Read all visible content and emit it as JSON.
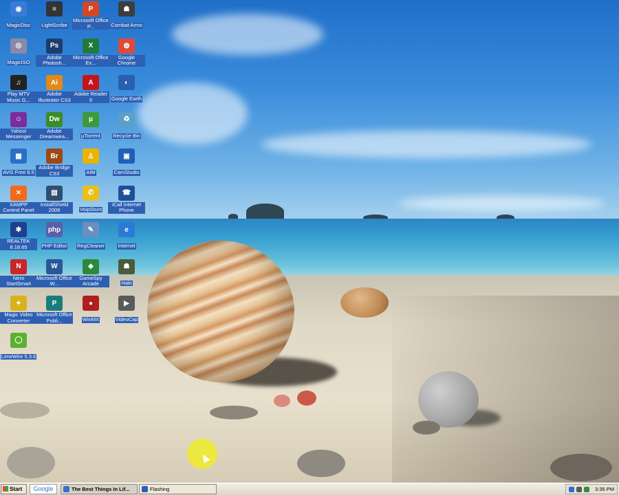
{
  "desktop_icons": [
    {
      "label": "MagicDisc",
      "icon": "disc-icon",
      "color": "#3a7bd5",
      "glyph": "◉"
    },
    {
      "label": "LightScribe",
      "icon": "lightscribe-icon",
      "color": "#333333",
      "glyph": "≡"
    },
    {
      "label": "Microsoft Office P...",
      "icon": "powerpoint-icon",
      "color": "#d24726",
      "glyph": "P"
    },
    {
      "label": "Combat Arms",
      "icon": "soldier-icon",
      "color": "#3d3d3d",
      "glyph": "☗"
    },
    {
      "label": "MagicISO",
      "icon": "cd-icon",
      "color": "#8a8aa8",
      "glyph": "◎"
    },
    {
      "label": "Adobe Photosh...",
      "icon": "photoshop-icon",
      "color": "#1d3c6e",
      "glyph": "Ps"
    },
    {
      "label": "Microsoft Office Ex...",
      "icon": "excel-icon",
      "color": "#1f7a3c",
      "glyph": "X"
    },
    {
      "label": "Google Chrome",
      "icon": "chrome-icon",
      "color": "#dd4b39",
      "glyph": "◍"
    },
    {
      "label": "Play MTV Music G...",
      "icon": "mtv-icon",
      "color": "#222222",
      "glyph": "♫"
    },
    {
      "label": "Adobe Illustrator CS3",
      "icon": "illustrator-icon",
      "color": "#e08a18",
      "glyph": "Ai"
    },
    {
      "label": "Adobe Reader 9",
      "icon": "pdf-icon",
      "color": "#c4151c",
      "glyph": "A"
    },
    {
      "label": "Google Earth",
      "icon": "globe-icon",
      "color": "#2a5fb0",
      "glyph": "◐"
    },
    {
      "label": "Yahoo! Messenger",
      "icon": "smiley-icon",
      "color": "#7b2d9c",
      "glyph": "☺"
    },
    {
      "label": "Adobe Dreamwea...",
      "icon": "dreamweaver-icon",
      "color": "#3b8c2a",
      "glyph": "Dw"
    },
    {
      "label": "µTorrent",
      "icon": "utorrent-icon",
      "color": "#3b9b3b",
      "glyph": "µ"
    },
    {
      "label": "Recycle Bin",
      "icon": "recycle-bin-icon",
      "color": "#5aa0c8",
      "glyph": "♻"
    },
    {
      "label": "AVG Free 8.5",
      "icon": "avg-icon",
      "color": "#2c6fc7",
      "glyph": "▦"
    },
    {
      "label": "Adobe Bridge CS3",
      "icon": "bridge-icon",
      "color": "#9b4a16",
      "glyph": "Br"
    },
    {
      "label": "AIM",
      "icon": "aim-icon",
      "color": "#e8b400",
      "glyph": "♙"
    },
    {
      "label": "CamStudio",
      "icon": "camstudio-icon",
      "color": "#1f5fb8",
      "glyph": "▣"
    },
    {
      "label": "XAMPP Control Panel",
      "icon": "xampp-icon",
      "color": "#f26a1b",
      "glyph": "⨯"
    },
    {
      "label": "InstallShield 2009",
      "icon": "installshield-icon",
      "color": "#2f4f6f",
      "glyph": "▤"
    },
    {
      "label": "VoipStunt",
      "icon": "voipstunt-icon",
      "color": "#e8c01a",
      "glyph": "✆"
    },
    {
      "label": "iCall Internet Phone",
      "icon": "phone-icon",
      "color": "#1c4f9c",
      "glyph": "☎"
    },
    {
      "label": "REALTEK 8.18.65",
      "icon": "realtek-icon",
      "color": "#1e3f8f",
      "glyph": "✱"
    },
    {
      "label": "PHP Editor",
      "icon": "php-icon",
      "color": "#5a5fa8",
      "glyph": "php"
    },
    {
      "label": "RegCleaner",
      "icon": "regcleaner-icon",
      "color": "#6b8fc0",
      "glyph": "✎"
    },
    {
      "label": "Internet",
      "icon": "internet-explorer-icon",
      "color": "#2a7bd6",
      "glyph": "e"
    },
    {
      "label": "Nero StartSmart",
      "icon": "nero-icon",
      "color": "#c9262b",
      "glyph": "N"
    },
    {
      "label": "Microsoft Office W...",
      "icon": "word-icon",
      "color": "#2b579a",
      "glyph": "W"
    },
    {
      "label": "GameSpy Arcade",
      "icon": "gamespy-icon",
      "color": "#2a8a3a",
      "glyph": "◈"
    },
    {
      "label": "Halo",
      "icon": "halo-icon",
      "color": "#4a5a3a",
      "glyph": "☗"
    },
    {
      "label": "Magic Video Converter",
      "icon": "video-converter-icon",
      "color": "#d9b21b",
      "glyph": "✦"
    },
    {
      "label": "Microsoft Office Publi...",
      "icon": "publisher-icon",
      "color": "#1a7d7d",
      "glyph": "P"
    },
    {
      "label": "WinMX",
      "icon": "winmx-icon",
      "color": "#b01e1e",
      "glyph": "●"
    },
    {
      "label": "VideoCap",
      "icon": "videocap-icon",
      "color": "#5a5a5a",
      "glyph": "▶"
    },
    {
      "label": "LimeWire 5.3.6",
      "icon": "limewire-icon",
      "color": "#5bb030",
      "glyph": "◯"
    }
  ],
  "taskbar": {
    "start_label": "Start",
    "google_label": "Google",
    "tasks": [
      {
        "label": "The Best Things In Lif...",
        "icon": "browser-window-icon",
        "color": "#3a6fc8",
        "active": true
      },
      {
        "label": "Flashing",
        "icon": "app-window-icon",
        "color": "#2d5fb3",
        "active": false
      }
    ],
    "tray_icons": [
      {
        "icon": "network-tray-icon",
        "color": "#2d6fd0"
      },
      {
        "icon": "volume-tray-icon",
        "color": "#5a5a5a"
      },
      {
        "icon": "shield-tray-icon",
        "color": "#3a8a3a"
      }
    ],
    "clock": "3:35 PM"
  }
}
